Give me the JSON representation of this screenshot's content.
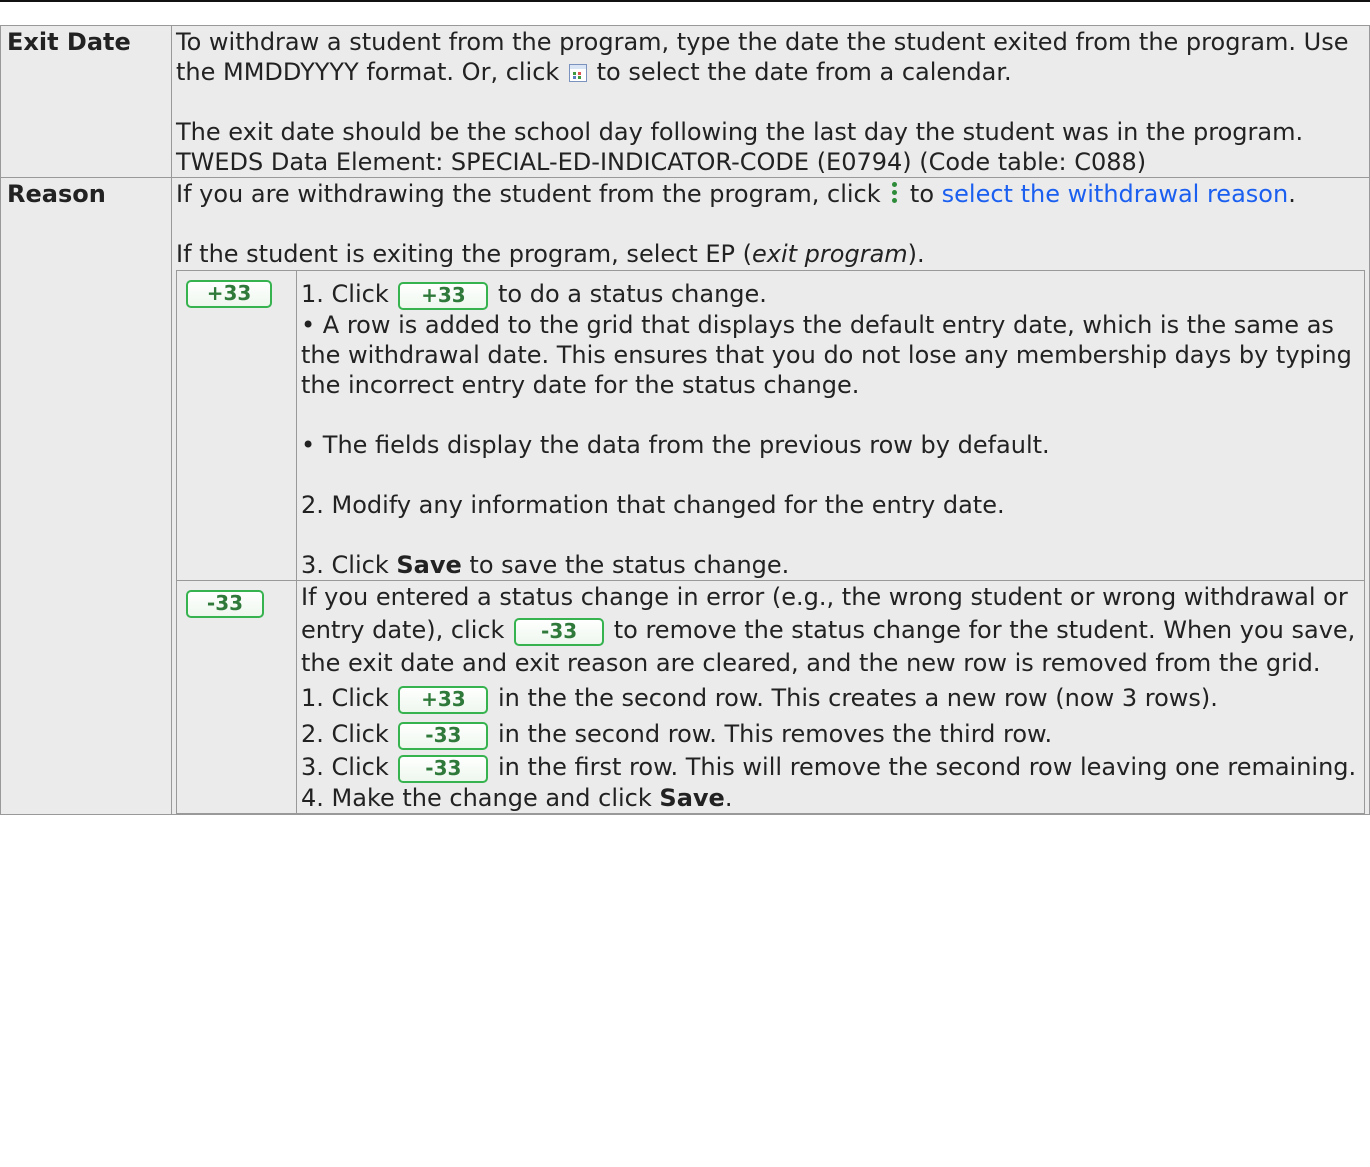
{
  "exit_date": {
    "label": "Exit Date",
    "p1_before": "To withdraw a student from the program, type the date the student exited from the program. Use the MMDDYYYY format. Or, click",
    "p1_after": "to select the date from a calendar.",
    "p2": "The exit date should be the school day following the last day the student was in the program.",
    "p3": "TWEDS Data Element: SPECIAL-ED-INDICATOR-CODE (E0794) (Code table: C088)"
  },
  "reason": {
    "label": "Reason",
    "p1_before": "If you are withdrawing the student from the program, click",
    "p1_mid": "to",
    "p1_link": "select the withdrawal reason",
    "p1_after": ".",
    "p2_before": "If the student is exiting the program, select EP (",
    "p2_em": "exit program",
    "p2_after": ")."
  },
  "buttons": {
    "add": "+33",
    "remove": "-33"
  },
  "add_row": {
    "step1_before": "1. Click",
    "step1_after": "to do a status change.",
    "bullet1": "• A row is added to the grid that displays the default entry date, which is the same as the withdrawal date. This ensures that you do not lose any membership days by typing the incorrect entry date for the status change.",
    "bullet2": "• The fields display the data from the previous row by default.",
    "step2": "2. Modify any information that changed for the entry date.",
    "step3_before": "3. Click",
    "step3_bold": "Save",
    "step3_after": "to save the status change."
  },
  "remove_row": {
    "intro_before": "If you entered a status change in error (e.g., the wrong student or wrong withdrawal or entry date), click",
    "intro_after": "to remove the status change for the student. When you save, the exit date and exit reason are cleared, and the new row is removed from the grid.",
    "s1_before": "1. Click",
    "s1_after": "in the the second row. This creates a new row (now 3 rows).",
    "s2_before": "2. Click",
    "s2_after": "in the second row. This removes the third row.",
    "s3_before": "3. Click",
    "s3_after": "in the first row. This will remove the second row leaving one remaining.",
    "s4_before": "4. Make the change and click",
    "s4_bold": "Save",
    "s4_after": "."
  }
}
